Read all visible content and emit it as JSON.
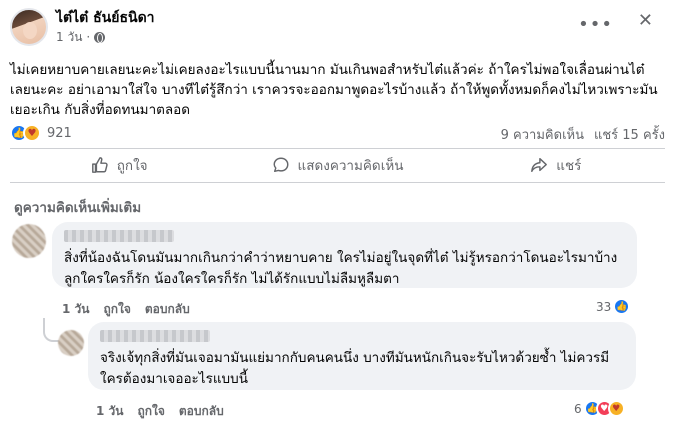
{
  "post": {
    "author": "ไต๋ไต๋ ธันย์ธนิดา",
    "time": "1 วัน",
    "text": "ไม่เคยหยาบคายเลยนะคะไม่เคยลงอะไรแบบนี้นานมาก มันเกินพอสำหรับไต๋แล้วค่ะ ถ้าใครไม่พอใจเลื่อนผ่านไต๋เลยนะคะ อย่าเอามาใส่ใจ บางทีไต๋รู้สึกว่า เราควรจะออกมาพูดอะไรบ้างแล้ว ถ้าให้พูดทั้งหมดก็คงไม่ไหวเพราะมันเยอะเกิน กับสิ่งที่อดทนมาตลอด",
    "reaction_count": "921",
    "comments_count": "9 ความคิดเห็น",
    "shares_count": "แชร์ 15 ครั้ง"
  },
  "actions": {
    "like": "ถูกใจ",
    "comment": "แสดงความคิดเห็น",
    "share": "แชร์"
  },
  "comments_header": "ดูความคิดเห็นเพิ่มเติม",
  "comments": [
    {
      "text": "สิ่งที่น้องฉันโดนมันมากเกินกว่าคำว่าหยาบคาย ใครไม่อยู่ในจุดที่ไต๋ ไม่รู้หรอกว่าโดนอะไรมาบ้าง ลูกใครใครก็รัก น้องใครใครก็รัก ไม่ได้รักแบบไม่ลืมหูลืมตา",
      "time": "1 วัน",
      "like": "ถูกใจ",
      "reply": "ตอบกลับ",
      "reactions": "33"
    },
    {
      "text": "จริงเจ้ทุกสิ่งที่มันเจอมามันแย่มากกับคนคนนึ่ง บางทีมันหนักเกินจะรับไหวด้วยซ้ำ ไม่ควรมีใครต้องมาเจออะไรแบบนี้",
      "time": "1 วัน",
      "like": "ถูกใจ",
      "reply": "ตอบกลับ",
      "reactions": "6"
    }
  ],
  "colors": {
    "accent": "#1877f2",
    "muted": "#65676b",
    "bubble": "#f0f2f5"
  }
}
